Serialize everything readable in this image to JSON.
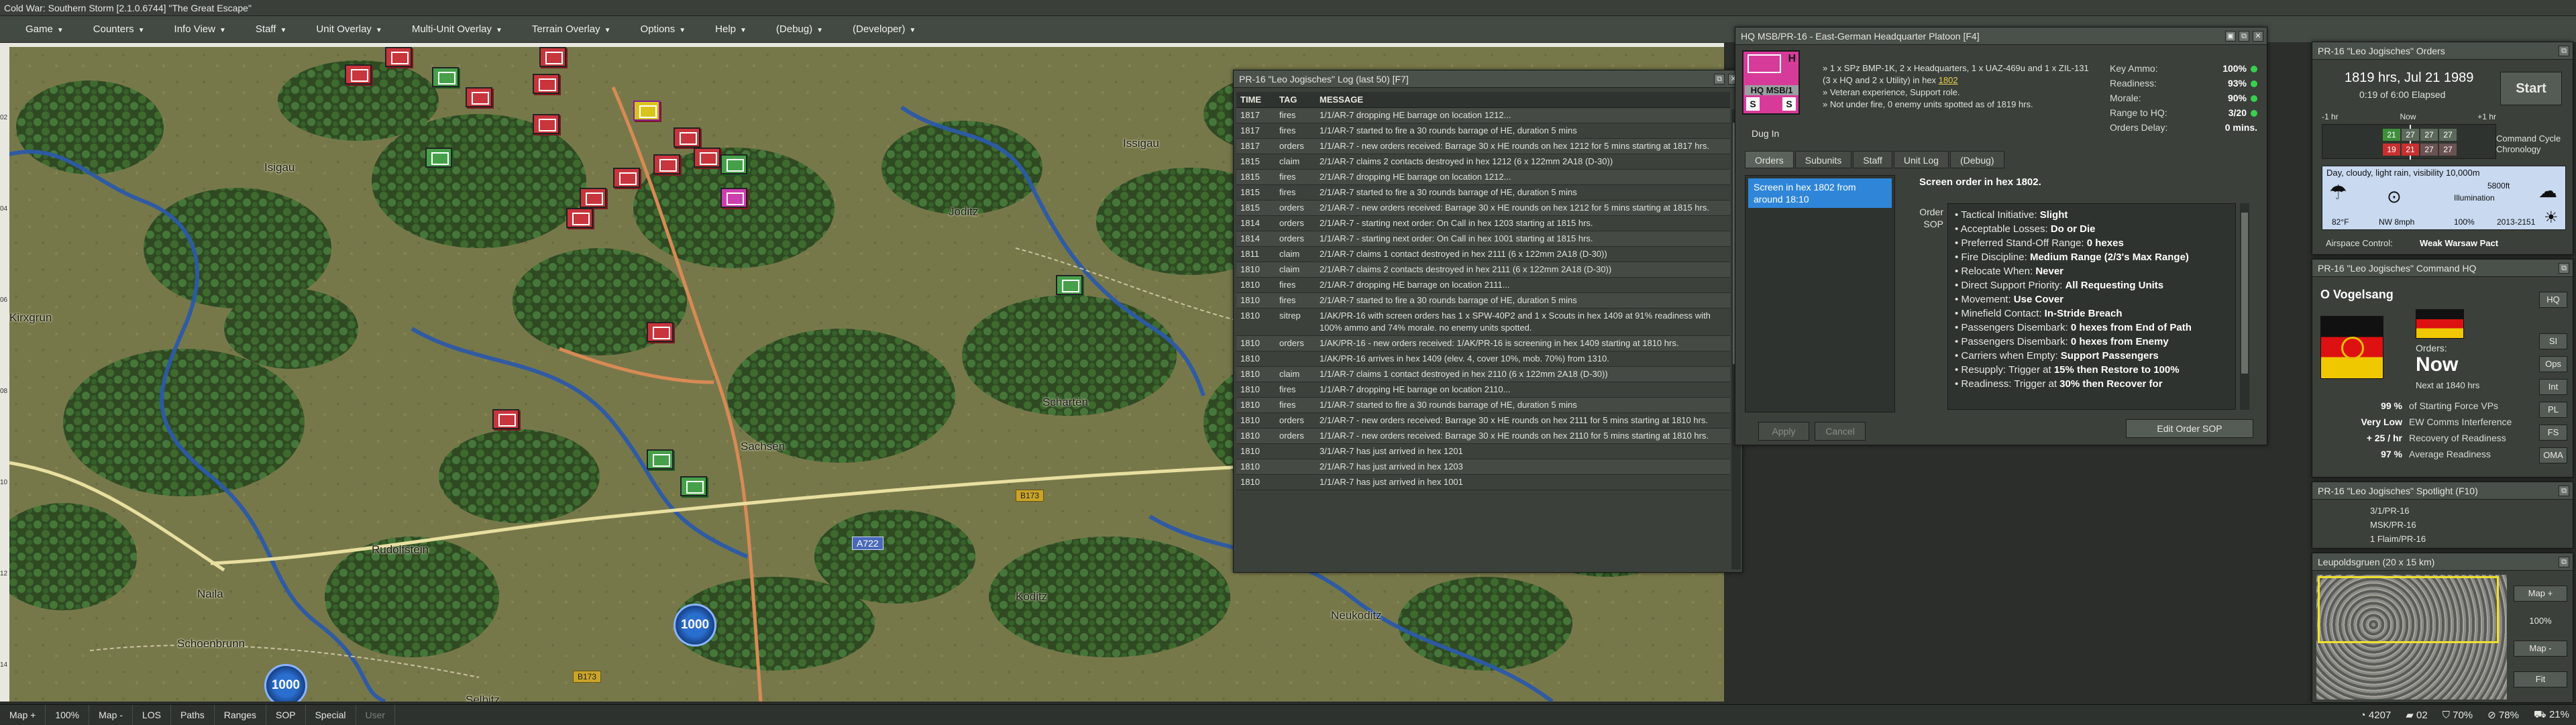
{
  "app": {
    "title": "Cold War: Southern Storm  [2.1.0.6744]  \"The Great Escape\""
  },
  "menu": [
    {
      "label": "Game"
    },
    {
      "label": "Counters"
    },
    {
      "label": "Info View"
    },
    {
      "label": "Staff"
    },
    {
      "label": "Unit Overlay"
    },
    {
      "label": "Multi-Unit Overlay"
    },
    {
      "label": "Terrain Overlay"
    },
    {
      "label": "Options"
    },
    {
      "label": "Help"
    },
    {
      "label": "(Debug)"
    },
    {
      "label": "(Developer)"
    }
  ],
  "map": {
    "towns": [
      {
        "name": "Isigau"
      },
      {
        "name": "Joditz"
      },
      {
        "name": "Issigau"
      },
      {
        "name": "Kirxgrun"
      },
      {
        "name": "Sachsen"
      },
      {
        "name": "Schartën"
      },
      {
        "name": "Rudolfstein"
      },
      {
        "name": "Naila"
      },
      {
        "name": "Koditz"
      },
      {
        "name": "Neukoditz"
      },
      {
        "name": "Selbitz"
      },
      {
        "name": "Schoenbrunn"
      }
    ],
    "roads": [
      {
        "label": "A722"
      },
      {
        "label": "B173"
      },
      {
        "label": "B173"
      }
    ],
    "markers": [
      {
        "label": "1000"
      },
      {
        "label": "1000"
      }
    ],
    "row_labels": [
      "02",
      "04",
      "06",
      "08",
      "10",
      "12",
      "14"
    ]
  },
  "log": {
    "title": "PR-16 \"Leo Jogisches\" Log (last 50)  [F7]",
    "columns": {
      "time": "TIME",
      "tag": "TAG",
      "message": "MESSAGE"
    },
    "rows": [
      {
        "time": "1817",
        "tag": "fires",
        "msg": "1/1/AR-7 dropping HE barrage on location 1212..."
      },
      {
        "time": "1817",
        "tag": "fires",
        "msg": "1/1/AR-7 started to fire a 30 rounds barrage of HE, duration 5 mins"
      },
      {
        "time": "1817",
        "tag": "orders",
        "msg": "1/1/AR-7 - new orders received: Barrage 30 x HE rounds on hex 1212 for 5 mins starting at 1817 hrs."
      },
      {
        "time": "1815",
        "tag": "claim",
        "msg": "2/1/AR-7 claims 2 contacts destroyed in hex 1212 (6 x 122mm 2A18 (D-30))"
      },
      {
        "time": "1815",
        "tag": "fires",
        "msg": "2/1/AR-7 dropping HE barrage on location 1212..."
      },
      {
        "time": "1815",
        "tag": "fires",
        "msg": "2/1/AR-7 started to fire a 30 rounds barrage of HE, duration 5 mins"
      },
      {
        "time": "1815",
        "tag": "orders",
        "msg": "2/1/AR-7 - new orders received: Barrage 30 x HE rounds on hex 1212 for 5 mins starting at 1815 hrs."
      },
      {
        "time": "1814",
        "tag": "orders",
        "msg": "2/1/AR-7 - starting next order: On Call in hex 1203 starting at 1815 hrs."
      },
      {
        "time": "1814",
        "tag": "orders",
        "msg": "1/1/AR-7 - starting next order: On Call in hex 1001 starting at 1815 hrs."
      },
      {
        "time": "1811",
        "tag": "claim",
        "msg": "2/1/AR-7 claims 1 contact destroyed in hex 2111 (6 x 122mm 2A18 (D-30))"
      },
      {
        "time": "1810",
        "tag": "claim",
        "msg": "2/1/AR-7 claims 2 contacts destroyed in hex 2111 (6 x 122mm 2A18 (D-30))"
      },
      {
        "time": "1810",
        "tag": "fires",
        "msg": "2/1/AR-7 dropping HE barrage on location 2111..."
      },
      {
        "time": "1810",
        "tag": "fires",
        "msg": "2/1/AR-7 started to fire a 30 rounds barrage of HE, duration 5 mins"
      },
      {
        "time": "1810",
        "tag": "sitrep",
        "msg": "1/AK/PR-16 with screen orders has 1 x SPW-40P2 and 1 x Scouts in hex 1409 at 91% readiness with 100% ammo and 74% morale. no enemy units spotted."
      },
      {
        "time": "1810",
        "tag": "orders",
        "msg": "1/AK/PR-16 - new orders received: 1/AK/PR-16 is screening in hex 1409 starting at 1810 hrs."
      },
      {
        "time": "1810",
        "tag": "",
        "msg": "1/AK/PR-16 arrives in hex 1409 (elev. 4, cover 10%, mob. 70%) from 1310."
      },
      {
        "time": "1810",
        "tag": "claim",
        "msg": "1/1/AR-7 claims 1 contact destroyed in hex 2110 (6 x 122mm 2A18 (D-30))"
      },
      {
        "time": "1810",
        "tag": "fires",
        "msg": "1/1/AR-7 dropping HE barrage on location 2110..."
      },
      {
        "time": "1810",
        "tag": "fires",
        "msg": "1/1/AR-7 started to fire a 30 rounds barrage of HE, duration 5 mins"
      },
      {
        "time": "1810",
        "tag": "orders",
        "msg": "2/1/AR-7 - new orders received: Barrage 30 x HE rounds on hex 2111 for 5 mins starting at 1810 hrs."
      },
      {
        "time": "1810",
        "tag": "orders",
        "msg": "1/1/AR-7 - new orders received: Barrage 30 x HE rounds on hex 2110 for 5 mins starting at 1810 hrs."
      },
      {
        "time": "1810",
        "tag": "",
        "msg": "3/1/AR-7 has just arrived in hex 1201"
      },
      {
        "time": "1810",
        "tag": "",
        "msg": "2/1/AR-7 has just arrived in hex 1203"
      },
      {
        "time": "1810",
        "tag": "",
        "msg": "1/1/AR-7 has just arrived in hex 1001"
      }
    ]
  },
  "hq": {
    "title": "HQ MSB/PR-16 - East-German Headquarter Platoon   [F4]",
    "counter": {
      "line1": "HQ MSB/1",
      "letters": [
        "H",
        "S",
        "S"
      ]
    },
    "posture": "Dug In",
    "desc1": "» 1 x SPz BMP-1K, 2 x Headquarters, 1 x UAZ-469u and 1 x ZIL-131 (3 x HQ and 2 x Utility) in hex ",
    "desc1_hex": "1802",
    "desc2": "» Veteran experience, Support role.",
    "desc3": "» Not under fire, 0 enemy units spotted as of 1819 hrs.",
    "stats": [
      {
        "label": "Key Ammo:",
        "value": "100%"
      },
      {
        "label": "Readiness:",
        "value": "93%"
      },
      {
        "label": "Morale:",
        "value": "90%"
      },
      {
        "label": "Range to HQ:",
        "value": "3/20"
      },
      {
        "label": "Orders Delay:",
        "value": "0 mins."
      }
    ],
    "tabs": [
      "Orders",
      "Subunits",
      "Staff",
      "Unit Log",
      "(Debug)"
    ],
    "order_item": "Screen in hex 1802 from around 18:10",
    "order_summary": "Screen order in hex 1802.",
    "order_sop_label": "Order SOP",
    "sop": [
      {
        "k": "Tactical Initiative: ",
        "v": "Slight"
      },
      {
        "k": "Acceptable Losses: ",
        "v": "Do or Die"
      },
      {
        "k": "Preferred Stand-Off Range: ",
        "v": "0 hexes"
      },
      {
        "k": "Fire Discipline: ",
        "v": "Medium Range (2/3's Max Range)"
      },
      {
        "k": "Relocate When: ",
        "v": "Never"
      },
      {
        "k": "Direct Support Priority: ",
        "v": "All Requesting Units"
      },
      {
        "k": "Movement: ",
        "v": "Use Cover"
      },
      {
        "k": "Minefield Contact: ",
        "v": "In-Stride Breach"
      },
      {
        "k": "Passengers Disembark: ",
        "v": "0 hexes from End of Path"
      },
      {
        "k": "Passengers Disembark: ",
        "v": "0 hexes from Enemy"
      },
      {
        "k": "Carriers when Empty: ",
        "v": "Support Passengers"
      },
      {
        "k": "Resupply: Trigger at ",
        "v": "15% then Restore to 100%"
      },
      {
        "k": "Readiness: Trigger at ",
        "v": "30% then Recover for"
      }
    ],
    "buttons": {
      "apply": "Apply",
      "cancel": "Cancel",
      "edit": "Edit Order SOP"
    }
  },
  "orders_panel": {
    "title": "PR-16 \"Leo Jogisches\" Orders",
    "datetime": "1819 hrs, Jul 21 1989",
    "elapsed": "0:19 of 6:00 Elapsed",
    "start": "Start",
    "cycle1": "Command Cycle",
    "cycle2": "Chronology",
    "timeline": {
      "left": "-1 hr",
      "mid": "Now",
      "right": "+1 hr"
    },
    "chrono_top": [
      "21",
      "27",
      "27",
      "27"
    ],
    "chrono_bot": [
      "19",
      "21",
      "27",
      "27"
    ],
    "weather": "Day, cloudy, light rain, visibility 10,000m",
    "temp": "82°F",
    "wind": "NW 8mph",
    "illum_label": "Illumination",
    "illum_pct": "100%",
    "ceiling": "5800ft",
    "sun": "2013-2151",
    "airspace_label": "Airspace Control:",
    "airspace": "Weak Warsaw Pact"
  },
  "cmd_hq": {
    "title": "PR-16 \"Leo Jogisches\" Command HQ",
    "commander": "O Vogelsang",
    "orders_label": "Orders:",
    "orders_value": "Now",
    "next": "Next at 1840 hrs",
    "stats": [
      {
        "v": "99 %",
        "l": "of Starting Force VPs"
      },
      {
        "v": "Very Low",
        "l": "EW Comms Interference"
      },
      {
        "v": "+ 25 / hr",
        "l": "Recovery of Readiness"
      },
      {
        "v": "97 %",
        "l": "Average Readiness"
      }
    ],
    "side_buttons": [
      "HQ",
      "SI",
      "Ops",
      "Int",
      "PL",
      "FS",
      "OMA"
    ]
  },
  "spotlight": {
    "title": "PR-16 \"Leo Jogisches\" Spotlight  (F10)",
    "items": [
      "3/1/PR-16",
      "MSK/PR-16",
      "1 Flaim/PR-16"
    ]
  },
  "minimap": {
    "title": "Leupoldsgruen (20 x 15 km)",
    "buttons": [
      "Map +",
      "100%",
      "Map -",
      "Fit"
    ]
  },
  "statusbar": {
    "left": [
      "Map +",
      "100%",
      "Map -",
      "LOS",
      "Paths",
      "Ranges",
      "SOP",
      "Special",
      "User"
    ],
    "right": [
      "4207",
      "02",
      "70%",
      "78%",
      "21%"
    ]
  }
}
